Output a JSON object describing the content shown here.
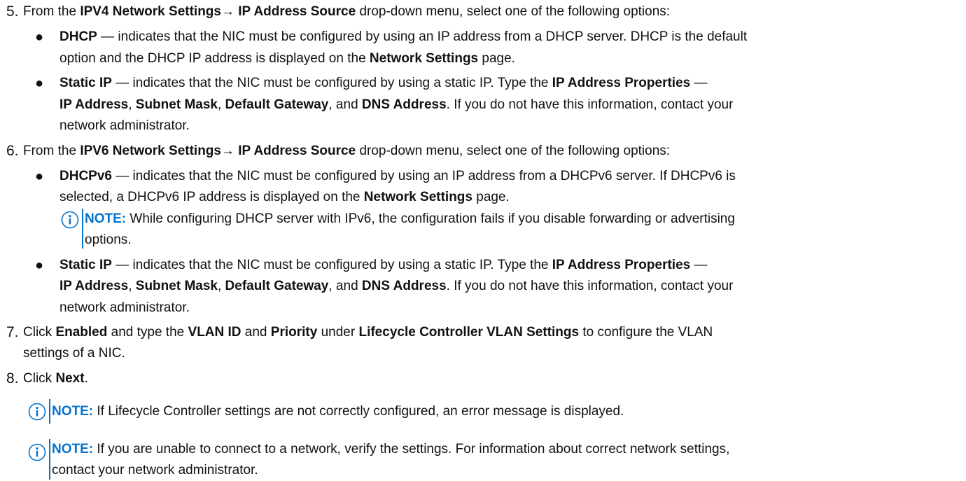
{
  "steps": [
    {
      "number": "5.",
      "intro": {
        "t1": "From the ",
        "b1": "IPV4 Network Settings",
        "arrow": "→",
        "b2": " IP Address Source",
        "t2": " drop-down menu, select one of the following options:"
      },
      "bullets": [
        {
          "term": "DHCP",
          "line1": " — indicates that the NIC must be configured by using an IP address from a DHCP server. DHCP is the default",
          "line2a": "option and the DHCP IP address is displayed on the ",
          "line2b": "Network Settings",
          "line2c": " page."
        },
        {
          "term": "Static IP",
          "line1a": " — indicates that the NIC must be configured by using a static IP. Type the ",
          "line1b": "IP Address Properties",
          "line1c": " —",
          "l2_ip": "IP Address",
          "l2_c1": ", ",
          "l2_subnet": "Subnet Mask",
          "l2_c2": ", ",
          "l2_gw": "Default Gateway",
          "l2_and": ", and ",
          "l2_dns": "DNS Address",
          "l2_rest": ". If you do not have this information, contact your",
          "line3": "network administrator."
        }
      ]
    },
    {
      "number": "6.",
      "intro": {
        "t1": "From the ",
        "b1": "IPV6 Network Settings",
        "arrow": "→",
        "b2": " IP Address Source",
        "t2": " drop-down menu, select one of the following options:"
      },
      "bullets": [
        {
          "term": "DHCPv6",
          "line1": " — indicates that the NIC must be configured by using an IP address from a DHCPv6 server. If DHCPv6 is",
          "line2a": "selected, a DHCPv6 IP address is displayed on the ",
          "line2b": "Network Settings",
          "line2c": " page.",
          "note_label": "NOTE:",
          "note_line1": " While configuring DHCP server with IPv6, the configuration fails if you disable forwarding or advertising",
          "note_line2": "options."
        },
        {
          "term": "Static IP",
          "line1a": " — indicates that the NIC must be configured by using a static IP. Type the ",
          "line1b": "IP Address Properties",
          "line1c": " —",
          "l2_ip": "IP Address",
          "l2_c1": ", ",
          "l2_subnet": "Subnet Mask",
          "l2_c2": ", ",
          "l2_gw": "Default Gateway",
          "l2_and": ", and ",
          "l2_dns": "DNS Address",
          "l2_rest": ". If you do not have this information, contact your",
          "line3": "network administrator."
        }
      ]
    },
    {
      "number": "7.",
      "line1": {
        "t1": "Click ",
        "b1": "Enabled",
        "t2": " and type the ",
        "b2": "VLAN ID",
        "t3": " and ",
        "b3": "Priority",
        "t4": " under ",
        "b4": "Lifecycle Controller VLAN Settings",
        "t5": " to configure the VLAN"
      },
      "line2": "settings of a NIC."
    },
    {
      "number": "8.",
      "t1": "Click ",
      "b1": "Next",
      "t2": "."
    }
  ],
  "notes": [
    {
      "label": "NOTE:",
      "line1": " If Lifecycle Controller settings are not correctly configured, an error message is displayed."
    },
    {
      "label": "NOTE:",
      "line1": " If you are unable to connect to a network, verify the settings. For information about correct network settings,",
      "line2": "contact your network administrator."
    }
  ],
  "colors": {
    "note_accent": "#0672cb",
    "text": "#111111"
  },
  "icons": {
    "note": "info-circle-icon",
    "bullet": "bullet-dot"
  }
}
